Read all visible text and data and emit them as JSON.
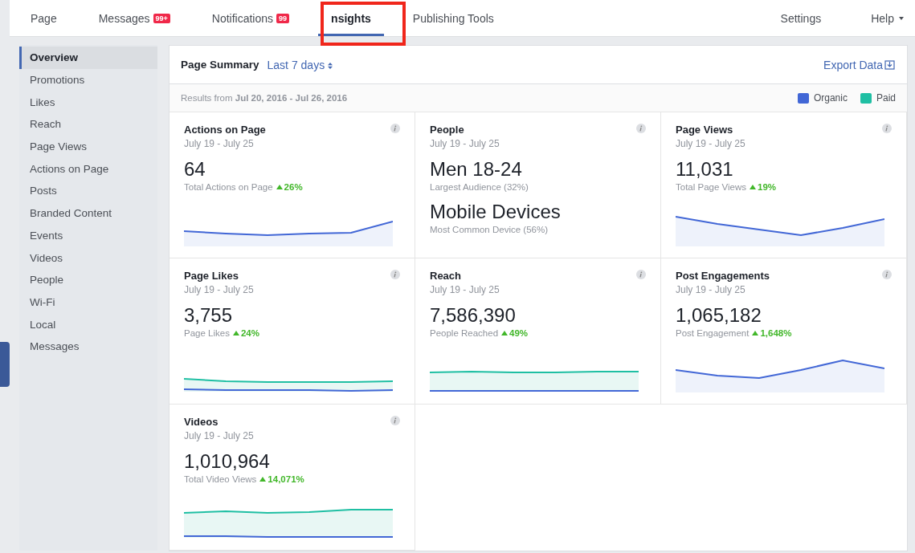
{
  "nav": {
    "tabs": [
      {
        "label": "Page",
        "selected": false
      },
      {
        "label": "Messages",
        "badge": "99+",
        "selected": false
      },
      {
        "label": "Notifications",
        "badge": "99",
        "selected": false
      },
      {
        "label": "nsights",
        "selected": true
      },
      {
        "label": "Publishing Tools",
        "selected": false
      }
    ],
    "right": [
      {
        "label": "Settings",
        "caret": false
      },
      {
        "label": "Help",
        "caret": true
      }
    ]
  },
  "sidebar": {
    "items": [
      {
        "label": "Overview",
        "selected": true
      },
      {
        "label": "Promotions",
        "selected": false
      },
      {
        "label": "Likes",
        "selected": false
      },
      {
        "label": "Reach",
        "selected": false
      },
      {
        "label": "Page Views",
        "selected": false
      },
      {
        "label": "Actions on Page",
        "selected": false
      },
      {
        "label": "Posts",
        "selected": false
      },
      {
        "label": "Branded Content",
        "selected": false
      },
      {
        "label": "Events",
        "selected": false
      },
      {
        "label": "Videos",
        "selected": false
      },
      {
        "label": "People",
        "selected": false
      },
      {
        "label": "Wi-Fi",
        "selected": false
      },
      {
        "label": "Local",
        "selected": false
      },
      {
        "label": "Messages",
        "selected": false
      }
    ]
  },
  "summary": {
    "title": "Page Summary",
    "range": "Last 7 days",
    "export": "Export Data",
    "results_prefix": "Results from",
    "results_dates": "Jul 20, 2016 - Jul 26, 2016",
    "legend": [
      {
        "label": "Organic",
        "color": "#4267d6"
      },
      {
        "label": "Paid",
        "color": "#1fbfa3"
      }
    ]
  },
  "cards": [
    {
      "kind": "organic",
      "title": "Actions on Page",
      "dates": "July 19 - July 25",
      "stats": [
        {
          "value": "64",
          "label": "Total Actions on Page",
          "change": "26%"
        }
      ]
    },
    {
      "kind": "text",
      "title": "People",
      "dates": "July 19 - July 25",
      "stats": [
        {
          "value": "Men 18-24",
          "label": "Largest Audience (32%)"
        },
        {
          "value": "Mobile Devices",
          "label": "Most Common Device (56%)"
        }
      ]
    },
    {
      "kind": "organic",
      "title": "Page Views",
      "dates": "July 19 - July 25",
      "stats": [
        {
          "value": "11,031",
          "label": "Total Page Views",
          "change": "19%"
        }
      ]
    },
    {
      "kind": "both",
      "title": "Page Likes",
      "dates": "July 19 - July 25",
      "stats": [
        {
          "value": "3,755",
          "label": "Page Likes",
          "change": "24%"
        }
      ]
    },
    {
      "kind": "both",
      "title": "Reach",
      "dates": "July 19 - July 25",
      "stats": [
        {
          "value": "7,586,390",
          "label": "People Reached",
          "change": "49%"
        }
      ]
    },
    {
      "kind": "organic",
      "title": "Post Engagements",
      "dates": "July 19 - July 25",
      "stats": [
        {
          "value": "1,065,182",
          "label": "Post Engagement",
          "change": "1,648%"
        }
      ]
    },
    {
      "kind": "both",
      "title": "Videos",
      "dates": "July 19 - July 25",
      "stats": [
        {
          "value": "1,010,964",
          "label": "Total Video Views",
          "change": "14,071%"
        }
      ]
    }
  ]
}
